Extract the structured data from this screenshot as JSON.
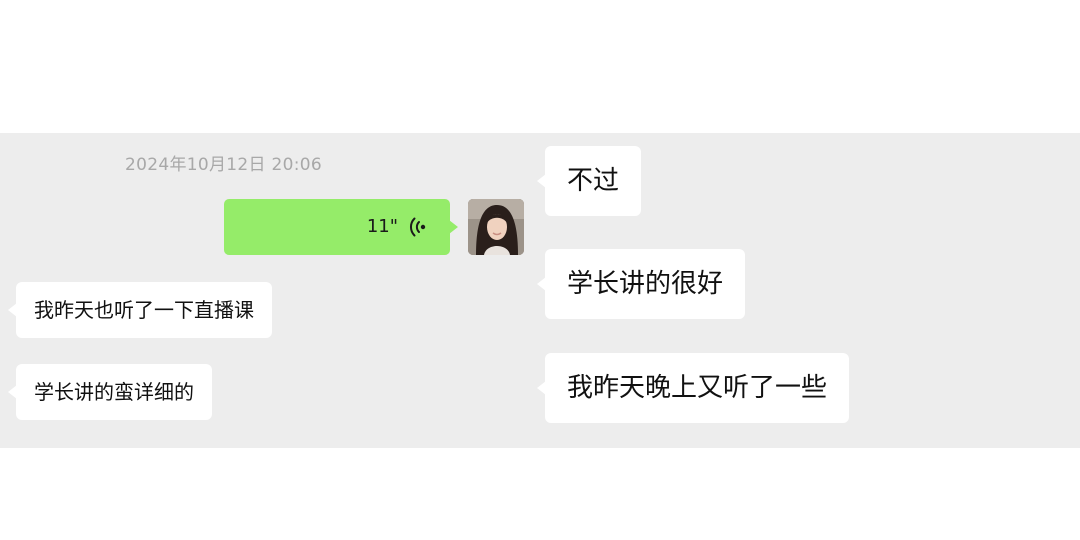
{
  "left_chat": {
    "timestamp": "2024年10月12日 20:06",
    "voice_message": {
      "duration": "11\""
    },
    "messages": [
      {
        "text": "我昨天也听了一下直播课"
      },
      {
        "text": "学长讲的蛮详细的"
      }
    ]
  },
  "right_chat": {
    "messages": [
      {
        "text": "不过"
      },
      {
        "text": "学长讲的很好"
      },
      {
        "text": "我昨天晚上又听了一些"
      }
    ]
  },
  "colors": {
    "chat_background": "#ededed",
    "sent_bubble": "#95ec69",
    "received_bubble": "#ffffff",
    "timestamp_text": "#a8a8a8"
  },
  "icons": [
    "voice-wave-icon",
    "avatar"
  ]
}
